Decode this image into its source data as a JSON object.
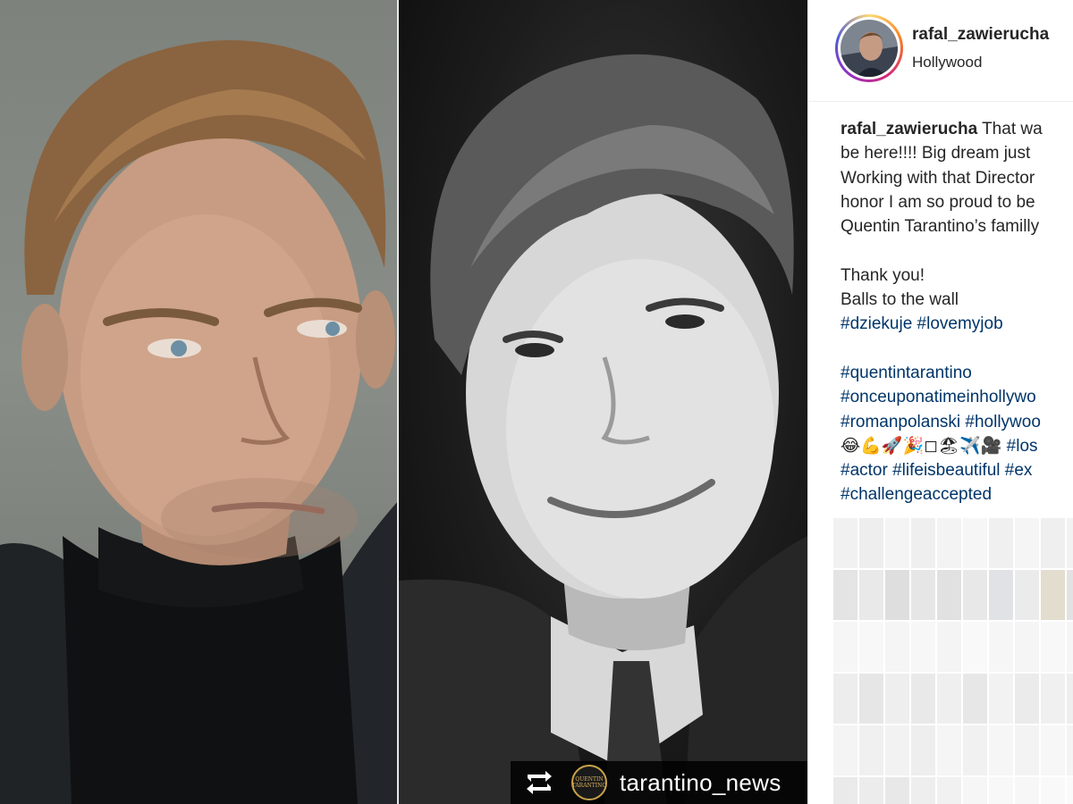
{
  "photo": {
    "repost_user": "tarantino_news",
    "repost_avatar_text": "QUENTIN TARANTINO"
  },
  "post": {
    "username": "rafal_zawierucha",
    "location": "Hollywood"
  },
  "caption": {
    "lines": [
      {
        "user": "rafal_zawierucha",
        "text": " That wa"
      },
      {
        "text": "be here!!!! Big dream just"
      },
      {
        "text": "Working with that Director"
      },
      {
        "text": "honor I am so proud to be"
      },
      {
        "text": "Quentin Tarantino’s familly"
      }
    ],
    "thanks": "Thank you!",
    "balls": "Balls to the wall",
    "tags_line1": "#dziekuje #lovemyjob",
    "tags": [
      "#quentintarantino",
      "#onceuponatimeinhollywo",
      "#romanpolanski #hollywoo"
    ],
    "emoji_line": "😂💪🚀🎉◻🏖✈️🎥",
    "emoji_tag": " #los",
    "tags_after": [
      "#actor #lifeisbeautiful #ex",
      "#challengeaccepted"
    ]
  },
  "colors": {
    "hashtag": "#003569",
    "text": "#262626",
    "divider": "#efefef"
  },
  "icons": {
    "repost": "repost-icon"
  }
}
